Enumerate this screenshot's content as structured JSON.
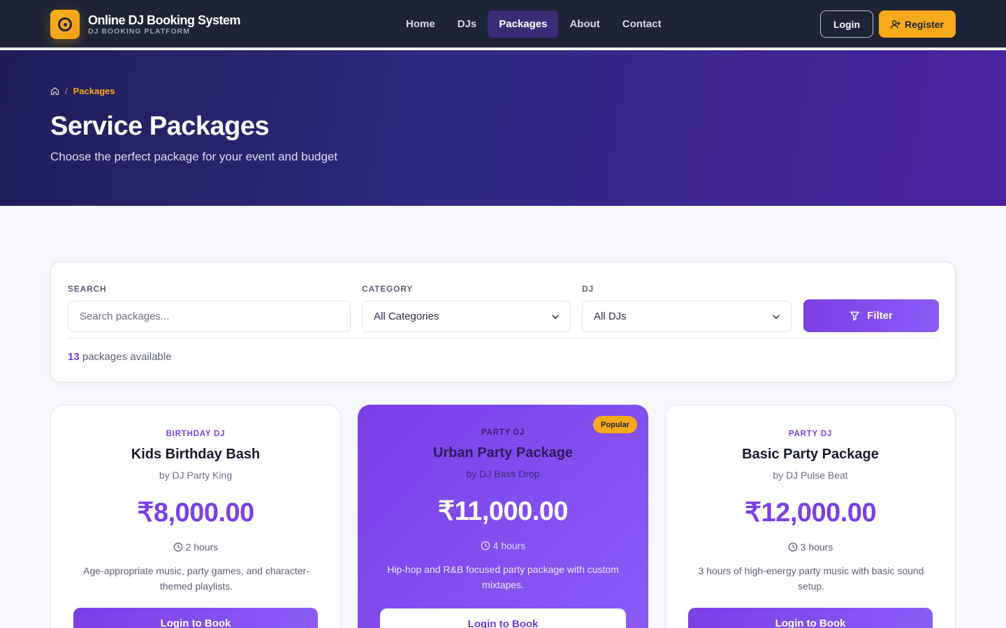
{
  "brand": {
    "title": "Online DJ Booking System",
    "subtitle": "DJ BOOKING PLATFORM"
  },
  "nav": {
    "links": [
      {
        "label": "Home"
      },
      {
        "label": "DJs"
      },
      {
        "label": "Packages"
      },
      {
        "label": "About"
      },
      {
        "label": "Contact"
      }
    ],
    "active": "Packages",
    "login_label": "Login",
    "register_label": "Register"
  },
  "hero": {
    "breadcrumb_current": "Packages",
    "title": "Service Packages",
    "subtitle": "Choose the perfect package for your event and budget"
  },
  "filters": {
    "search_label": "SEARCH",
    "search_placeholder": "Search packages...",
    "category_label": "CATEGORY",
    "category_value": "All Categories",
    "dj_label": "DJ",
    "dj_value": "All DJs",
    "filter_button": "Filter",
    "count": "13",
    "count_text": "packages available"
  },
  "packages": [
    {
      "category": "BIRTHDAY DJ",
      "name": "Kids Birthday Bash",
      "by": "by DJ Party King",
      "price": "₹8,000.00",
      "duration": "2 hours",
      "description": "Age-appropriate music, party games, and character-themed playlists.",
      "button": "Login to Book"
    },
    {
      "category": "PARTY DJ",
      "name": "Urban Party Package",
      "by": "by DJ Bass Drop",
      "price": "₹11,000.00",
      "duration": "4 hours",
      "description": "Hip-hop and R&B focused party package with custom mixtapes.",
      "button": "Login to Book",
      "badge": "Popular"
    },
    {
      "category": "PARTY DJ",
      "name": "Basic Party Package",
      "by": "by DJ Pulse Beat",
      "price": "₹12,000.00",
      "duration": "3 hours",
      "description": "3 hours of high-energy party music with basic sound setup.",
      "button": "Login to Book"
    }
  ],
  "colors": {
    "accent": "#7b3fe4",
    "brand_yellow": "#f6a91b",
    "nav_bg": "#1e2335",
    "hero_start": "#1f1d58",
    "hero_end": "#4c24a1"
  }
}
